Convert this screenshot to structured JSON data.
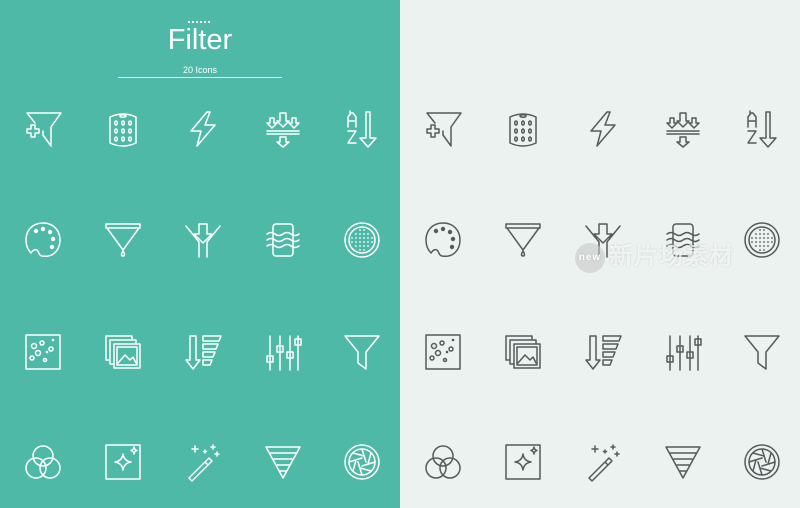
{
  "header": {
    "title": "Filter",
    "subtitle": "20 Icons"
  },
  "colors": {
    "left_background": "#4fb9a7",
    "right_background": "#ebf2f0",
    "left_icon": "#ffffff",
    "right_icon": "#555a5a"
  },
  "icons": [
    "filter-plus-icon",
    "filter-cartridge-icon",
    "lightning-icon",
    "compress-arrows-icon",
    "sort-a-z-icon",
    "palette-icon",
    "cone-drip-icon",
    "funnel-arrow-icon",
    "water-filter-icon",
    "mesh-strainer-icon",
    "particles-square-icon",
    "photo-stack-icon",
    "sort-descending-icon",
    "equalizer-icon",
    "funnel-icon",
    "color-circles-icon",
    "sparkle-square-icon",
    "magic-wand-icon",
    "layered-triangle-icon",
    "aperture-icon"
  ],
  "watermark": {
    "logo_text": "new",
    "text": "新片场素材"
  }
}
